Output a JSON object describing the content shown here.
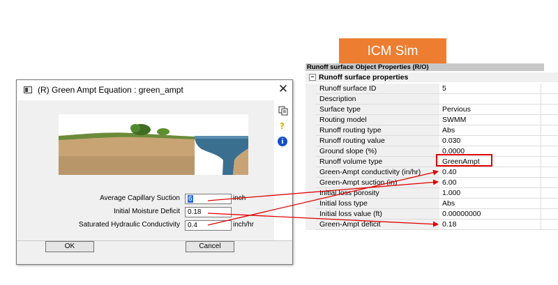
{
  "dialog": {
    "title": "(R) Green Ampt Equation : green_ampt",
    "close_glyph": "✕",
    "help_glyph": "?",
    "info_glyph": "i",
    "fields": [
      {
        "label": "Average Capillary Suction",
        "value": "6",
        "unit": "inch"
      },
      {
        "label": "Initial Moisture Deficit",
        "value": "0.18",
        "unit": ""
      },
      {
        "label": "Saturated Hydraulic Conductivity",
        "value": "0.4",
        "unit": "inch/hr"
      }
    ],
    "ok_label": "OK",
    "cancel_label": "Cancel"
  },
  "badge": {
    "label": "ICM Sim",
    "color": "#ED7D31"
  },
  "properties": {
    "header": "Runoff surface Object Properties (R/O)",
    "section": "Runoff surface properties",
    "collapse_glyph": "−",
    "rows": [
      {
        "name": "Runoff surface ID",
        "value": "5"
      },
      {
        "name": "Description",
        "value": ""
      },
      {
        "name": "Surface type",
        "value": "Pervious"
      },
      {
        "name": "Routing model",
        "value": "SWMM"
      },
      {
        "name": "Runoff routing type",
        "value": "Abs"
      },
      {
        "name": "Runoff routing value",
        "value": "0.030"
      },
      {
        "name": "Ground slope (%)",
        "value": "0.0000"
      },
      {
        "name": "Runoff volume type",
        "value": "GreenAmpt"
      },
      {
        "name": "Green-Ampt conductivity (in/hr)",
        "value": "0.40"
      },
      {
        "name": "Green-Ampt suction (in)",
        "value": "6.00"
      },
      {
        "name": "Initial loss porosity",
        "value": "1.000"
      },
      {
        "name": "Initial loss type",
        "value": "Abs"
      },
      {
        "name": "Initial loss value (ft)",
        "value": "0.00000000"
      },
      {
        "name": "Green-Ampt deficit",
        "value": "0.18"
      }
    ]
  },
  "annotation_color": "#E00000",
  "icons": [
    "app-icon",
    "close-icon",
    "copy-icon",
    "help-icon",
    "info-icon",
    "collapse-icon",
    "soil-profile-illustration"
  ]
}
